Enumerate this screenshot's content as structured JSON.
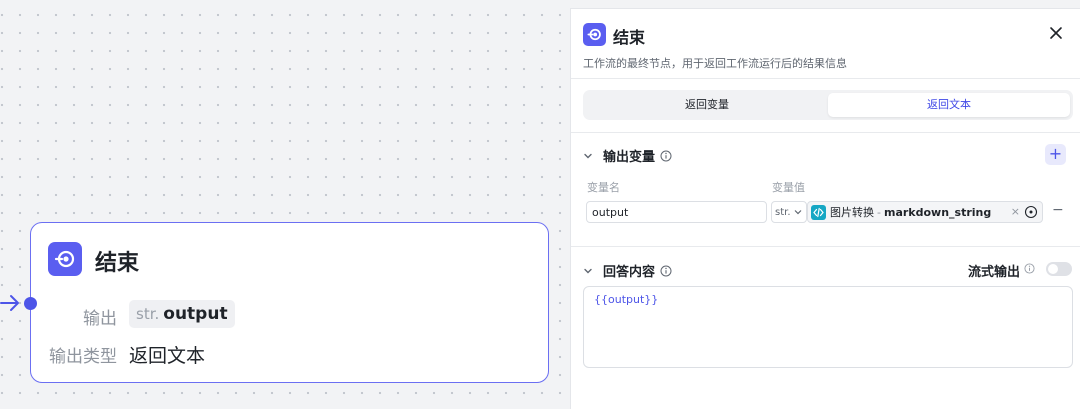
{
  "node": {
    "title": "结束",
    "output_label": "输出",
    "output_type_tag": "str.",
    "output_name": "output",
    "output_kind_label": "输出类型",
    "output_kind_value": "返回文本"
  },
  "panel": {
    "title": "结束",
    "description": "工作流的最终节点，用于返回工作流运行后的结果信息",
    "tabs": [
      {
        "label": "返回变量",
        "active": false
      },
      {
        "label": "返回文本",
        "active": true
      }
    ],
    "output_vars": {
      "header": "输出变量",
      "add_label": "+",
      "col_name": "变量名",
      "col_value": "变量值",
      "rows": [
        {
          "name": "output",
          "type": "str.",
          "ref_source": "图片转换",
          "ref_sep": "-",
          "ref_var": "markdown_string",
          "remove": "−",
          "clear": "×"
        }
      ]
    },
    "answer": {
      "header": "回答内容",
      "stream_label": "流式输出",
      "stream_enabled": false,
      "content": "{{output}}"
    }
  },
  "colors": {
    "accent": "#5a5ef0",
    "accent_text": "#3f47e6",
    "ref_icon": "#16a7c4"
  }
}
